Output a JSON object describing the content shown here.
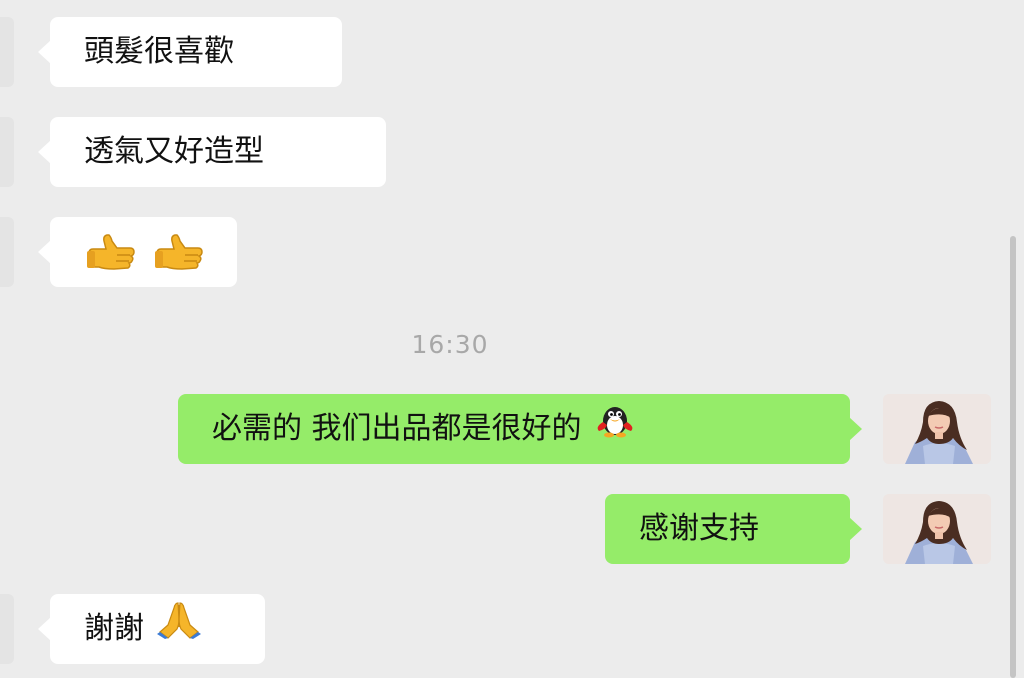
{
  "conversation": {
    "messages": [
      {
        "direction": "incoming",
        "text": "頭髮很喜歡"
      },
      {
        "direction": "incoming",
        "text": "透氣又好造型"
      },
      {
        "direction": "incoming",
        "text": "",
        "emojis": [
          "thumbs-up",
          "thumbs-up"
        ]
      },
      {
        "direction": "outgoing",
        "text": "必需的 我们出品都是很好的",
        "emojis": [
          "penguin"
        ]
      },
      {
        "direction": "outgoing",
        "text": "感谢支持"
      },
      {
        "direction": "incoming",
        "text": "謝謝",
        "emojis": [
          "folded-hands"
        ]
      }
    ],
    "timestamp": "16:30"
  },
  "colors": {
    "background": "#ececec",
    "incoming_bubble": "#ffffff",
    "outgoing_bubble": "#95ec69",
    "timestamp_text": "#a8a8a8"
  },
  "icons": [
    "thumbs-up-icon",
    "penguin-icon",
    "folded-hands-icon",
    "user-avatar"
  ]
}
